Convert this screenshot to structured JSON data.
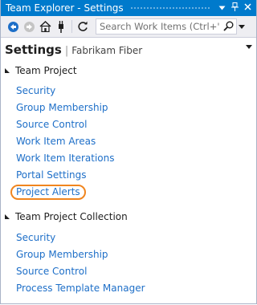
{
  "window": {
    "title": "Team Explorer - Settings",
    "buttons": [
      {
        "name": "dropdown-icon",
        "glyph": "▾"
      },
      {
        "name": "pin-icon",
        "glyph": "ᵖ"
      },
      {
        "name": "close-icon",
        "glyph": "✕"
      }
    ]
  },
  "toolbar": {
    "icons": [
      "back-icon",
      "forward-icon",
      "home-icon",
      "connect-icon",
      "refresh-icon"
    ],
    "search_placeholder": "Search Work Items (Ctrl+')"
  },
  "header": {
    "title": "Settings",
    "project": "Fabrikam Fiber"
  },
  "sections": [
    {
      "label": "Team Project",
      "items": [
        "Security",
        "Group Membership",
        "Source Control",
        "Work Item Areas",
        "Work Item Iterations",
        "Portal Settings",
        "Project Alerts"
      ],
      "highlighted": "Project Alerts"
    },
    {
      "label": "Team Project Collection",
      "items": [
        "Security",
        "Group Membership",
        "Source Control",
        "Process Template Manager"
      ]
    }
  ],
  "colors": {
    "titlebar": "#007acc",
    "link": "#1e6fc8",
    "highlight": "#f0851e",
    "toolbar_bg": "#eeeef2"
  }
}
